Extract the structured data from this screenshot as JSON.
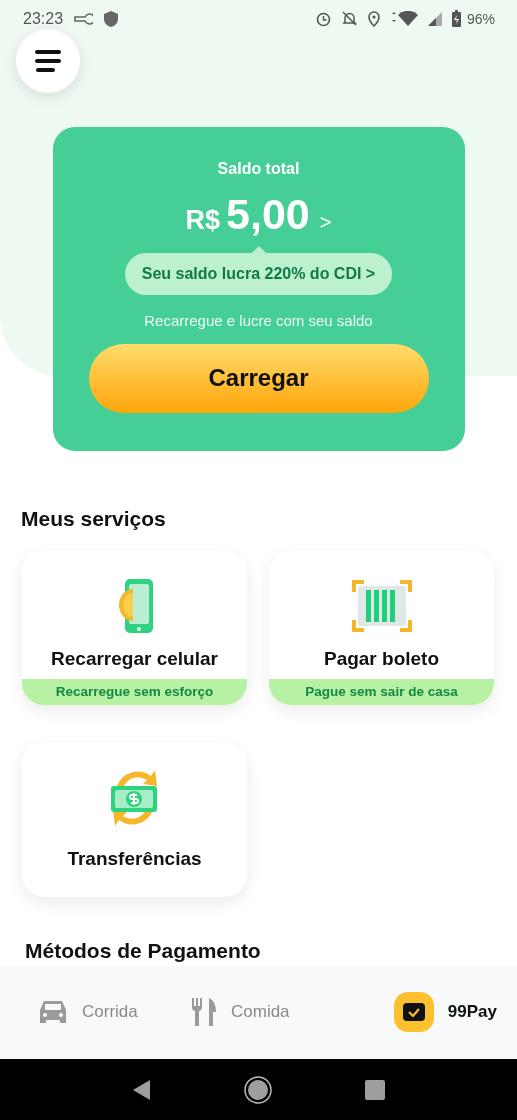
{
  "status_bar": {
    "time": "23:23",
    "battery": "96%"
  },
  "balance": {
    "label": "Saldo total",
    "currency": "R$",
    "amount": "5,00",
    "arrow": ">",
    "promo": "Seu saldo lucra 220% do CDI >",
    "hint": "Recarregue e lucre com seu saldo",
    "button": "Carregar"
  },
  "services": {
    "title": "Meus serviços",
    "items": [
      {
        "kind": "phone",
        "title": "Recarregar celular",
        "subtitle": "Recarregue sem esforço"
      },
      {
        "kind": "barcode",
        "title": "Pagar boleto",
        "subtitle": "Pague sem sair de casa"
      },
      {
        "kind": "transfer",
        "title": "Transferências"
      }
    ]
  },
  "payment_methods": {
    "title": "Métodos de Pagamento"
  },
  "bottom_nav": [
    {
      "kind": "car",
      "label": "Corrida",
      "selected": false
    },
    {
      "kind": "food",
      "label": "Comida",
      "selected": false
    },
    {
      "kind": "wallet",
      "label": "99Pay",
      "selected": true
    }
  ]
}
